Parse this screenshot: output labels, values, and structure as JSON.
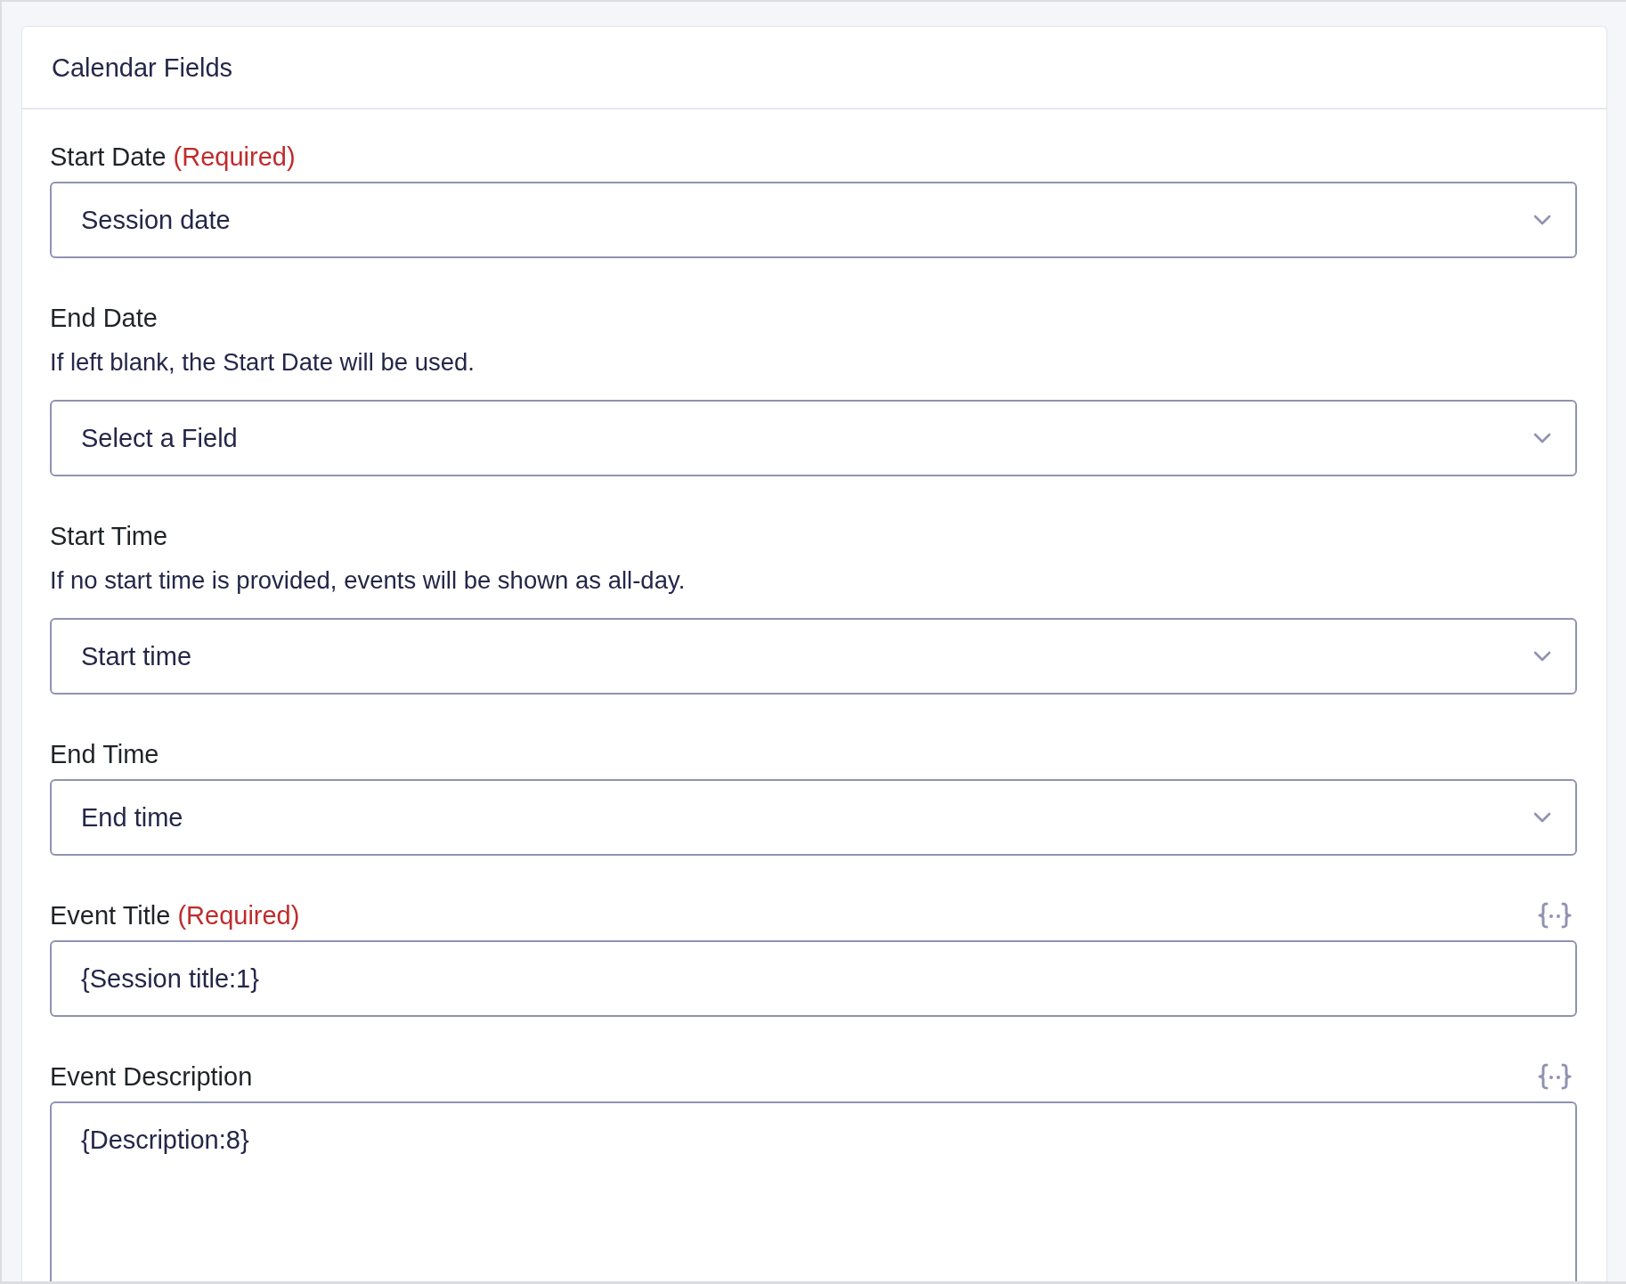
{
  "panel": {
    "title": "Calendar Fields"
  },
  "fields": [
    {
      "kind": "select",
      "label": "Start Date",
      "required_label": "(Required)",
      "merge_tags": false,
      "value": "Session date"
    },
    {
      "kind": "select",
      "label": "End Date",
      "description": "If left blank, the Start Date will be used.",
      "merge_tags": false,
      "value": "Select a Field"
    },
    {
      "kind": "select",
      "label": "Start Time",
      "description": "If no start time is provided, events will be shown as all-day.",
      "merge_tags": false,
      "value": "Start time"
    },
    {
      "kind": "select",
      "label": "End Time",
      "merge_tags": false,
      "value": "End time"
    },
    {
      "kind": "text",
      "label": "Event Title",
      "required_label": "(Required)",
      "merge_tags": true,
      "value": "{Session title:1}"
    },
    {
      "kind": "textarea",
      "label": "Event Description",
      "merge_tags": true,
      "value": "{Description:8}"
    }
  ]
}
